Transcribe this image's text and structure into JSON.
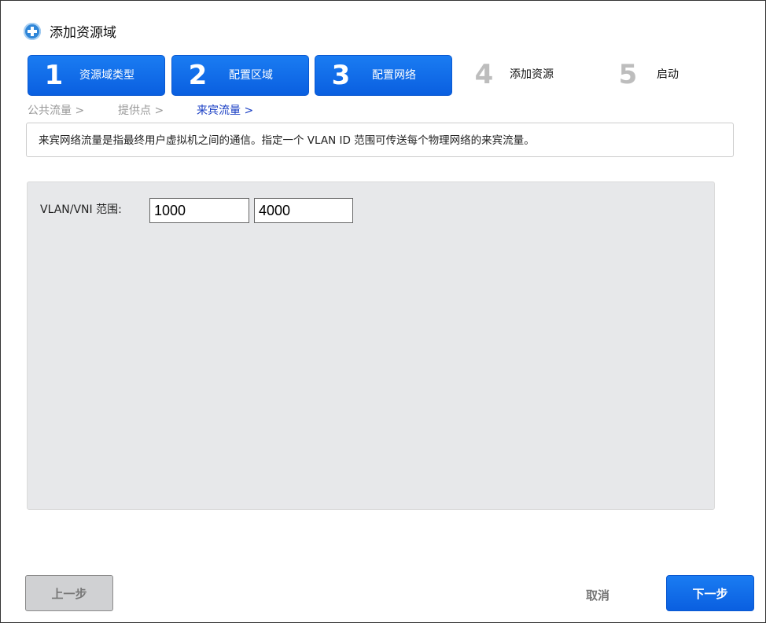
{
  "window": {
    "title": "添加资源域",
    "title_icon": "plus-circle-icon"
  },
  "steps": [
    {
      "num": "1",
      "label": "资源域类型",
      "state": "active"
    },
    {
      "num": "2",
      "label": "配置区域",
      "state": "active"
    },
    {
      "num": "3",
      "label": "配置网络",
      "state": "active"
    },
    {
      "num": "4",
      "label": "添加资源",
      "state": "inactive"
    },
    {
      "num": "5",
      "label": "启动",
      "state": "inactive"
    }
  ],
  "subnav": [
    {
      "label": "公共流量 >",
      "current": false
    },
    {
      "label": "提供点 >",
      "current": false
    },
    {
      "label": "来宾流量 >",
      "current": true
    }
  ],
  "description": "来宾网络流量是指最终用户虚拟机之间的通信。指定一个 VLAN ID 范围可传送每个物理网络的来宾流量。",
  "form": {
    "range_label": "VLAN/VNI 范围:",
    "range_start": "1000",
    "range_end": "4000"
  },
  "buttons": {
    "prev": "上一步",
    "cancel": "取消",
    "next": "下一步"
  },
  "colors": {
    "accent": "#0a6ae8",
    "panel_bg": "#e7e8ea",
    "current_link": "#1a3fc4"
  }
}
